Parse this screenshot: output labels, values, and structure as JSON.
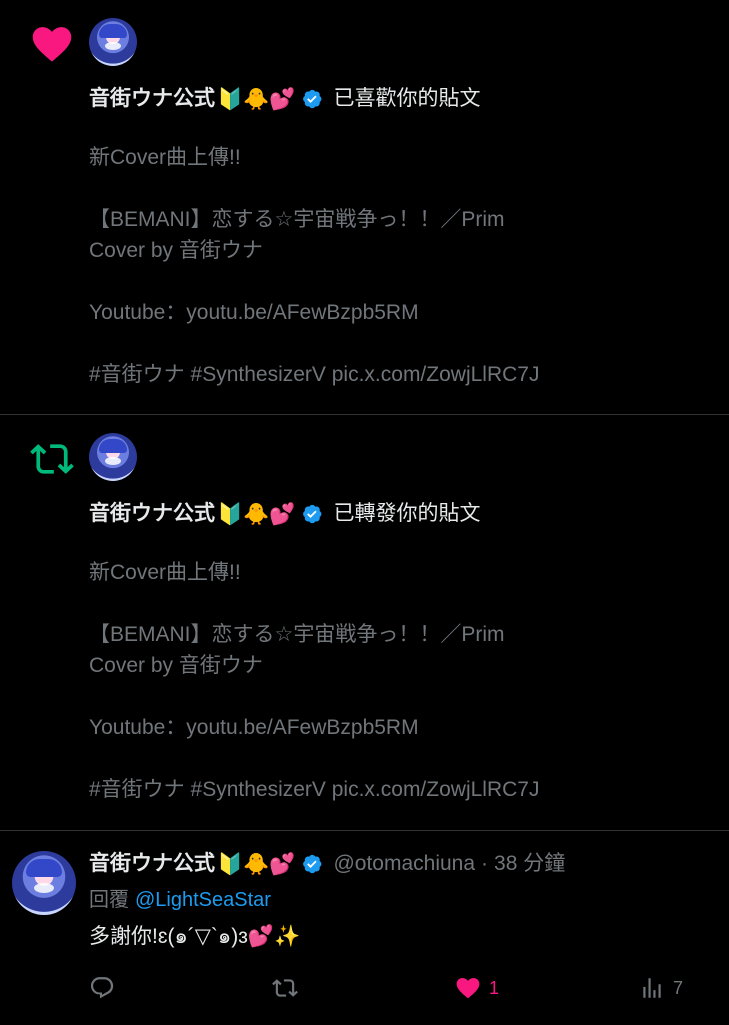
{
  "colors": {
    "like": "#f91880",
    "retweet": "#00ba7c",
    "link": "#1d9bf0",
    "muted": "#71767b",
    "verified": "#1d9bf0"
  },
  "notifications": [
    {
      "type_icon": "heart-icon",
      "user_name": "音街ウナ公式",
      "emojis": "🔰🐥💕",
      "action": "已喜歡你的貼文",
      "post_lines": [
        "新Cover曲上傳!!",
        "",
        "【BEMANI】恋する☆宇宙戦争っ！！／Prim",
        "Cover by 音街ウナ",
        "",
        "Youtube：youtu.be/AFewBzpb5RM",
        "",
        "#音街ウナ #SynthesizerV pic.x.com/ZowjLlRC7J"
      ]
    },
    {
      "type_icon": "retweet-icon",
      "user_name": "音街ウナ公式",
      "emojis": "🔰🐥💕",
      "action": "已轉發你的貼文",
      "post_lines": [
        "新Cover曲上傳!!",
        "",
        "【BEMANI】恋する☆宇宙戦争っ！！／Prim",
        "Cover by 音街ウナ",
        "",
        "Youtube：youtu.be/AFewBzpb5RM",
        "",
        "#音街ウナ #SynthesizerV pic.x.com/ZowjLlRC7J"
      ]
    }
  ],
  "reply": {
    "user_name": "音街ウナ公式",
    "emojis": "🔰🐥💕",
    "handle": "@otomachiuna",
    "separator": "·",
    "time": "38 分鐘",
    "reply_prefix": "回覆",
    "reply_to": "@LightSeaStar",
    "text": "多謝你!ɛ(๑´▽`๑)ɜ💕✨",
    "stats": {
      "likes": "1",
      "views": "7"
    }
  }
}
